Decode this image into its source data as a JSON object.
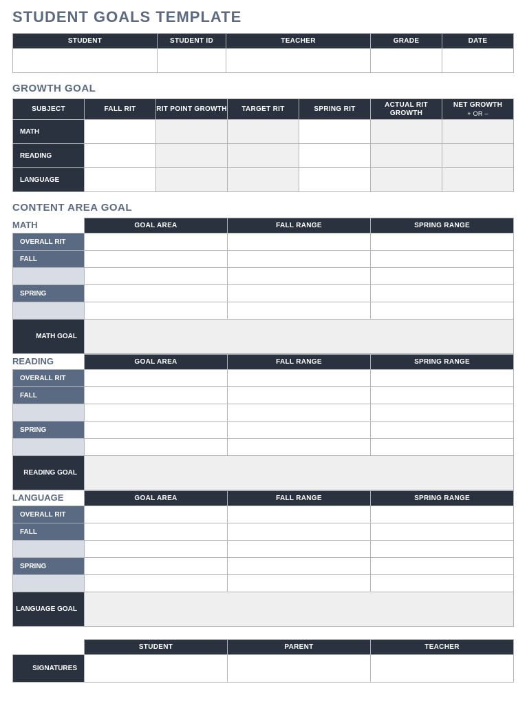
{
  "title": "STUDENT GOALS TEMPLATE",
  "info_headers": [
    "STUDENT",
    "STUDENT ID",
    "TEACHER",
    "GRADE",
    "DATE"
  ],
  "growth": {
    "title": "GROWTH GOAL",
    "headers": [
      "SUBJECT",
      "FALL RIT",
      "RIT POINT GROWTH",
      "TARGET RIT",
      "SPRING RIT",
      "ACTUAL RIT GROWTH",
      "NET GROWTH"
    ],
    "net_sub": "+ OR –",
    "rows": [
      "MATH",
      "READING",
      "LANGUAGE"
    ]
  },
  "content": {
    "title": "CONTENT AREA GOAL",
    "col_headers": [
      "GOAL AREA",
      "FALL RANGE",
      "SPRING RANGE"
    ],
    "row_labels": [
      "OVERALL RIT",
      "FALL",
      "",
      "SPRING",
      ""
    ],
    "sections": [
      {
        "name": "MATH",
        "goal_label": "MATH GOAL"
      },
      {
        "name": "READING",
        "goal_label": "READING GOAL"
      },
      {
        "name": "LANGUAGE",
        "goal_label": "LANGUAGE GOAL"
      }
    ]
  },
  "signatures": {
    "label": "SIGNATURES",
    "cols": [
      "STUDENT",
      "PARENT",
      "TEACHER"
    ]
  }
}
